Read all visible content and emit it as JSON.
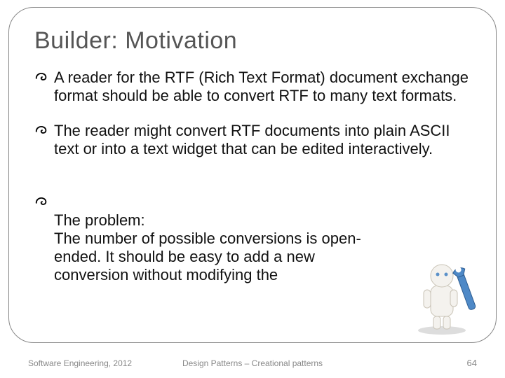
{
  "title": "Builder: Motivation",
  "bullets": [
    " A reader for the RTF (Rich Text Format) document exchange format should be able to convert RTF to many text formats.",
    "The reader might convert RTF documents into plain ASCII text or into a text widget that can be edited interactively.",
    "The problem:\nThe number of possible conversions is open-ended. It should be easy to add a new conversion without modifying the"
  ],
  "footer": {
    "left": "Software Engineering, 2012",
    "center": "Design Patterns – Creational patterns",
    "right": "64"
  },
  "icons": {
    "bullet": "swirl-icon",
    "figure": "character-wrench-icon"
  }
}
